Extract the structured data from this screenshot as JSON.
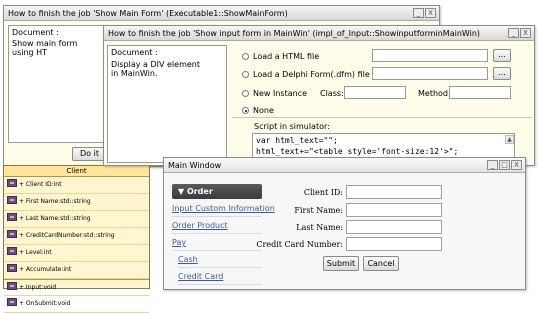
{
  "win1": {
    "title": "How to finish the job 'Show Main Form' (Executable1::ShowMainForm)",
    "doc_label": "Document :",
    "doc_text": "Show main form using HT",
    "do_it": "Do it"
  },
  "class_box": {
    "title": "Client",
    "rows": [
      "+ Client ID:int",
      "+ First Name:std::string",
      "+ Last Name:std::string",
      "+ CreditCardNumber:std::string",
      "+ Level:int",
      "+ Accumulate:int",
      "+ Input:void",
      "+ OnSubmit:void"
    ]
  },
  "win2": {
    "title": "How to finish the job 'Show input form in MainWin' (impl_of_Input::ShowinputforminMainWin)",
    "doc_label": "Document :",
    "doc_text": "Display a DIV element in MainWin.",
    "opt_html": "Load a HTML file",
    "opt_delphi": "Load a Delphi Form(.dfm) file",
    "opt_new": "New Instance",
    "class_label": "Class:",
    "method_label": "Method:",
    "opt_none": "None",
    "browse": "...",
    "script_label": "Script in simulator:",
    "code_line1": "var html_text=\"\";",
    "code_line2": "html_text+=\"<table style='font-size:12'>\";"
  },
  "win3": {
    "title": "Main Window",
    "nav_head": "▼ Order",
    "nav_items": [
      "Input Custom Information",
      "Order Product",
      "Pay"
    ],
    "nav_sub": [
      "Cash",
      "Credit Card"
    ],
    "fields": [
      "Client ID:",
      "First Name:",
      "Last Name:",
      "Credit Card Number:"
    ],
    "submit": "Submit",
    "cancel": "Cancel"
  },
  "ctrl": {
    "min": "_",
    "close": "X",
    "max": "□"
  }
}
